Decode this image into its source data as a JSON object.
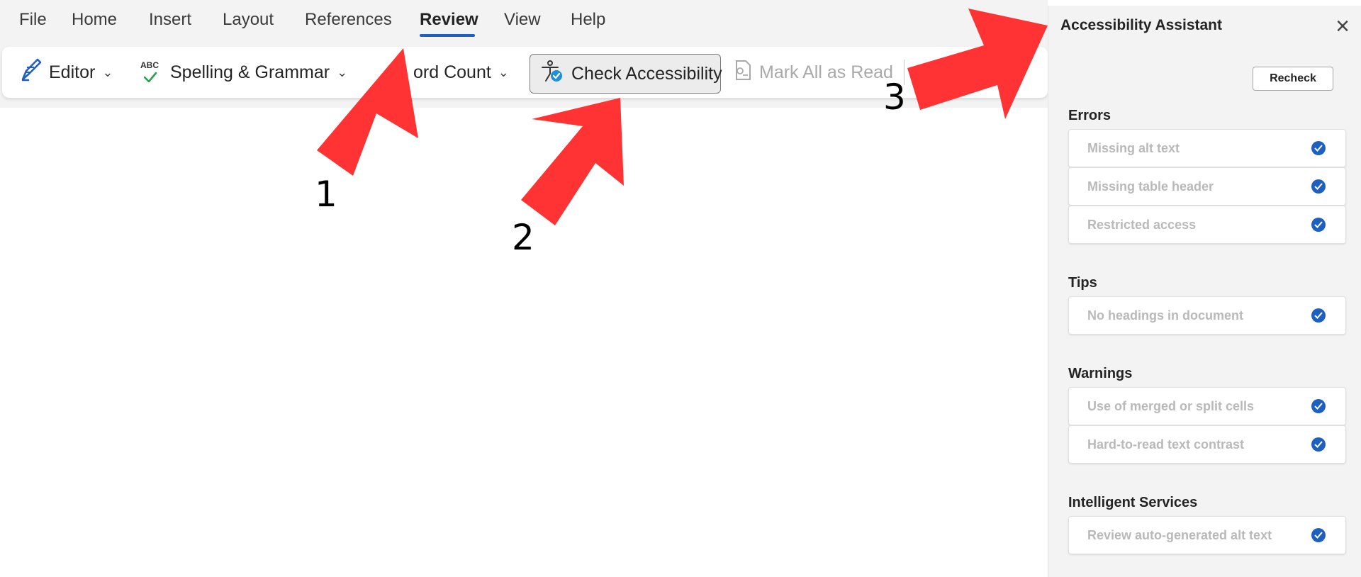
{
  "menu": {
    "items": [
      "File",
      "Home",
      "Insert",
      "Layout",
      "References",
      "Review",
      "View",
      "Help"
    ],
    "active": "Review"
  },
  "ribbon": {
    "editor_label": "Editor",
    "spelling_label": "Spelling & Grammar",
    "word_count_label": "ord Count",
    "check_accessibility_label": "Check Accessibility",
    "mark_all_label": "Mark All as Read",
    "spelling_icon_text": "ABC"
  },
  "annotations": {
    "step1": "1",
    "step2": "2",
    "step3": "3",
    "arrow_color": "#ff3333"
  },
  "pane": {
    "title": "Accessibility Assistant",
    "recheck_label": "Recheck",
    "sections": {
      "errors": {
        "heading": "Errors",
        "items": [
          "Missing alt text",
          "Missing table header",
          "Restricted access"
        ]
      },
      "tips": {
        "heading": "Tips",
        "items": [
          "No headings in document"
        ]
      },
      "warnings": {
        "heading": "Warnings",
        "items": [
          "Use of merged or split cells",
          "Hard-to-read text contrast"
        ]
      },
      "intelligent": {
        "heading": "Intelligent Services",
        "items": [
          "Review auto-generated alt text"
        ]
      }
    },
    "check_color": "#1f5fbf"
  }
}
